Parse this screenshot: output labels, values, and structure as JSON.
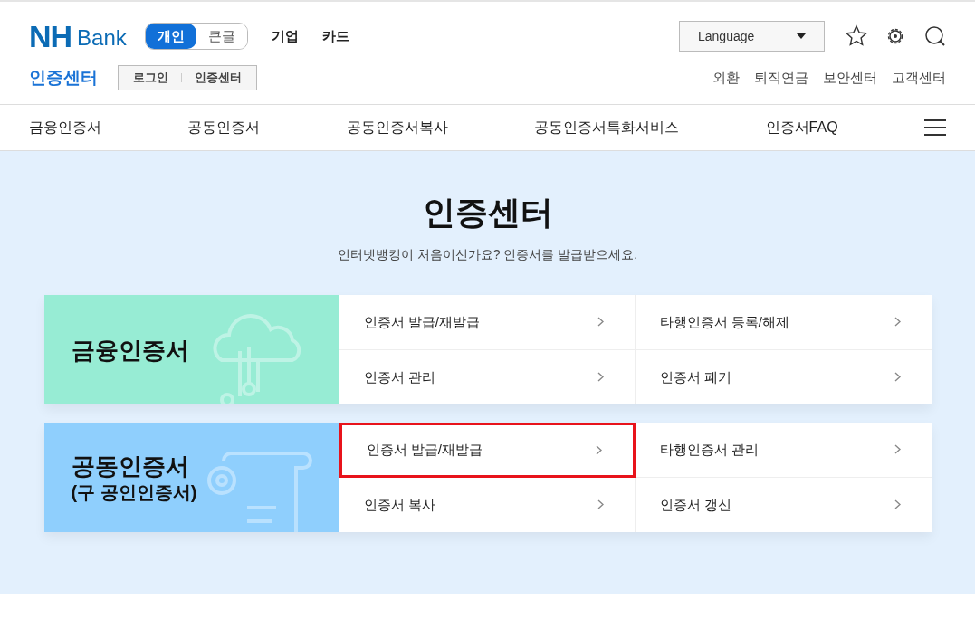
{
  "header": {
    "logo": {
      "mark": "NH",
      "text": "Bank"
    },
    "modes": [
      {
        "label": "개인",
        "selected": true
      },
      {
        "label": "큰글",
        "selected": false
      }
    ],
    "top_links": [
      "기업",
      "카드"
    ],
    "language": "Language",
    "section_title": "인증센터",
    "breadcrumbs": [
      "로그인",
      "인증센터"
    ],
    "util_links": [
      "외환",
      "퇴직연금",
      "보안센터",
      "고객센터"
    ]
  },
  "nav": [
    "금융인증서",
    "공동인증서",
    "공동인증서복사",
    "공동인증서특화서비스",
    "인증서FAQ"
  ],
  "hero": {
    "title": "인증센터",
    "subtitle": "인터넷뱅킹이 처음이신가요? 인증서를 발급받으세요."
  },
  "groups": [
    {
      "kind": "cloud",
      "title": "금융인증서",
      "items": [
        {
          "label": "인증서 발급/재발급",
          "highlighted": false
        },
        {
          "label": "타행인증서 등록/해제",
          "highlighted": false
        },
        {
          "label": "인증서 관리",
          "highlighted": false
        },
        {
          "label": "인증서 폐기",
          "highlighted": false
        }
      ]
    },
    {
      "kind": "scroll",
      "title": "공동인증서",
      "subtitle": "(구 공인인증서)",
      "items": [
        {
          "label": "인증서 발급/재발급",
          "highlighted": true
        },
        {
          "label": "타행인증서 관리",
          "highlighted": false
        },
        {
          "label": "인증서 복사",
          "highlighted": false
        },
        {
          "label": "인증서 갱신",
          "highlighted": false
        }
      ]
    }
  ]
}
